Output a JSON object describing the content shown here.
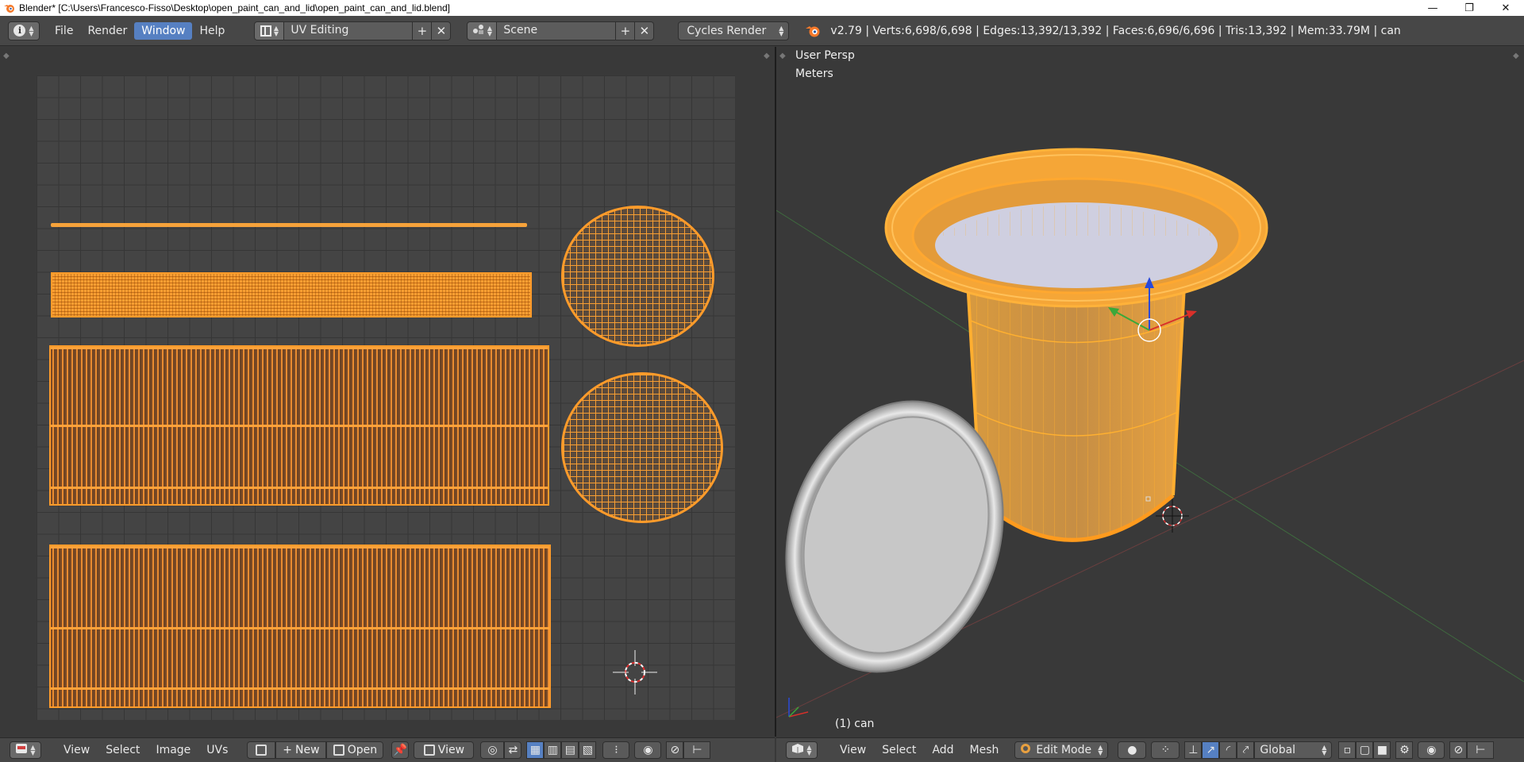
{
  "window": {
    "title": "Blender* [C:\\Users\\Francesco-Fisso\\Desktop\\open_paint_can_and_lid\\open_paint_can_and_lid.blend]",
    "minimize_glyph": "—",
    "maximize_glyph": "❐",
    "close_glyph": "✕"
  },
  "info_header": {
    "editor_icon": "info-icon",
    "menus": [
      {
        "label": "File",
        "active": false
      },
      {
        "label": "Render",
        "active": false
      },
      {
        "label": "Window",
        "active": true
      },
      {
        "label": "Help",
        "active": false
      }
    ],
    "screen_layout": "UV Editing",
    "scene": "Scene",
    "render_engine": "Cycles Render",
    "stats": "v2.79 | Verts:6,698/6,698 | Edges:13,392/13,392 | Faces:6,696/6,696 | Tris:13,392 | Mem:33.79M | can",
    "add_glyph": "+",
    "remove_glyph": "✕"
  },
  "uv_editor": {
    "header_menus": [
      "View",
      "Select",
      "Image",
      "UVs"
    ],
    "new_label": "New",
    "open_label": "Open",
    "view_label": "View",
    "accent_color": "#ff9b2a"
  },
  "viewport": {
    "view_name": "User Persp",
    "units": "Meters",
    "object_label": "(1) can",
    "header_menus": [
      "View",
      "Select",
      "Add",
      "Mesh"
    ],
    "mode": "Edit Mode",
    "orientation": "Global",
    "axis_x_color": "#d9302a",
    "axis_y_color": "#3aa83a",
    "axis_z_color": "#2a4ad9"
  }
}
